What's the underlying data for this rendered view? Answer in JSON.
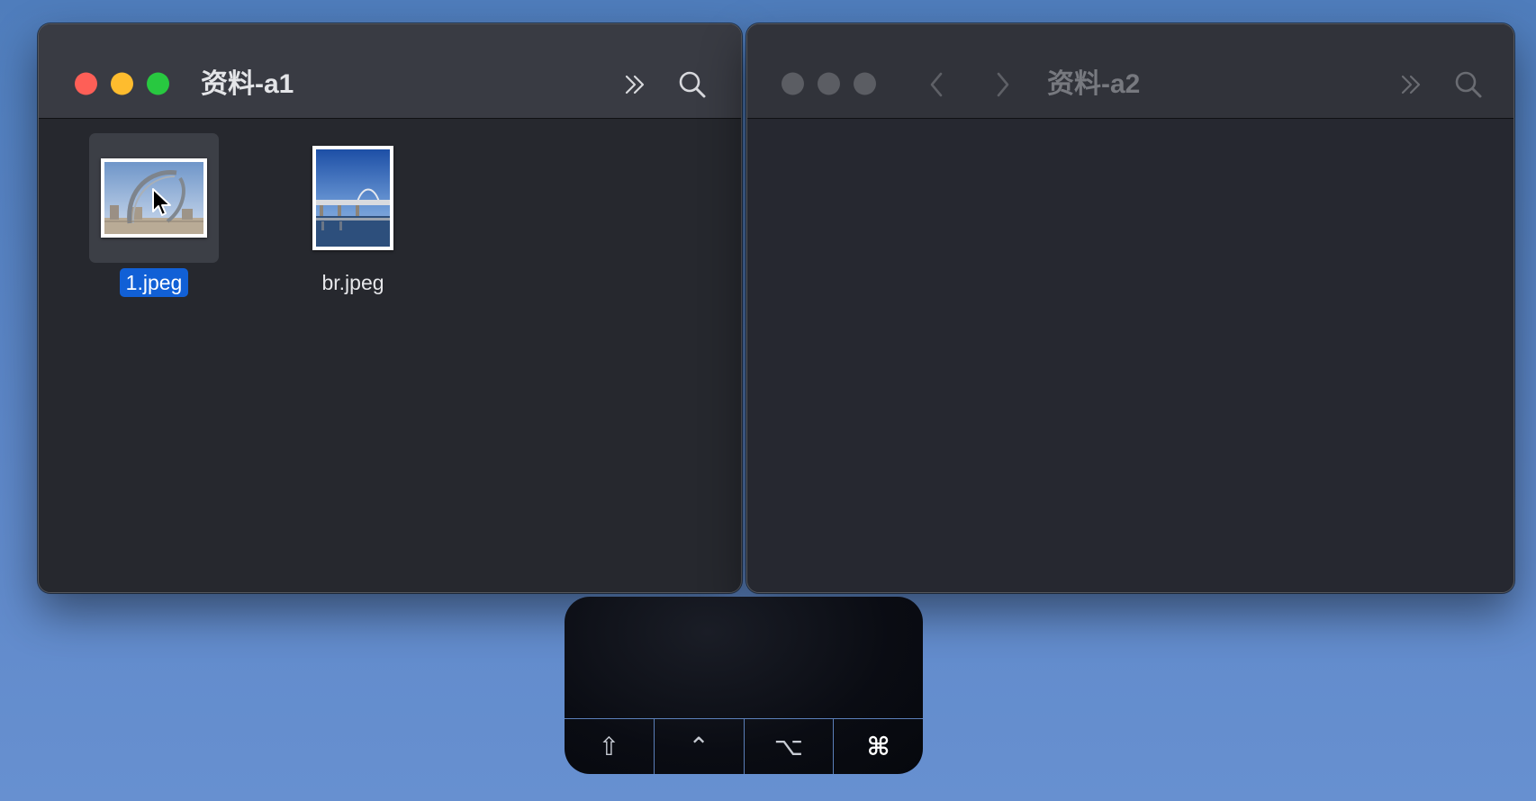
{
  "windows": [
    {
      "id": "a1",
      "title": "资料-a1",
      "active": true,
      "files": [
        {
          "name": "1.jpeg",
          "selected": true
        },
        {
          "name": "br.jpeg",
          "selected": false
        }
      ]
    },
    {
      "id": "a2",
      "title": "资料-a2",
      "active": false,
      "files": []
    }
  ],
  "icons": {
    "more": "chevron-double-right-icon",
    "search": "magnifying-glass-icon",
    "back": "chevron-left-icon",
    "forward": "chevron-right-icon"
  },
  "colors": {
    "desktop": "#5d87c8",
    "selection": "#1160d6",
    "close": "#fe5f57",
    "minimize": "#febc2e",
    "maximize": "#28c840"
  },
  "keys": [
    {
      "glyph": "⇧",
      "name": "shift",
      "active": false
    },
    {
      "glyph": "⌃",
      "name": "control",
      "active": false
    },
    {
      "glyph": "⌥",
      "name": "option",
      "active": false
    },
    {
      "glyph": "⌘",
      "name": "command",
      "active": true
    }
  ]
}
